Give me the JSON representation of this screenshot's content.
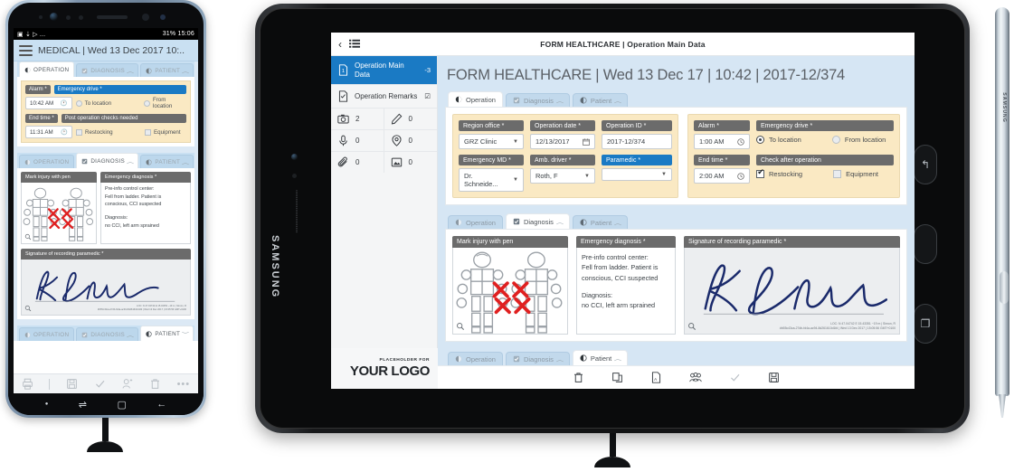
{
  "phone": {
    "statusbar": {
      "left_icons": "▣ ⇣ ▷ ...",
      "right": "31%  15:06"
    },
    "title": "MEDICAL | Wed 13 Dec 2017 10:..",
    "menu_icon": "hamburger-icon",
    "tabs_top": [
      {
        "label": "OPERATION",
        "icon": "operation-icon",
        "active": true,
        "chevron": ""
      },
      {
        "label": "DIAGNOSIS",
        "icon": "diagnosis-icon",
        "active": false,
        "chevron": "︿"
      },
      {
        "label": "PATIENT",
        "icon": "patient-icon",
        "active": false,
        "chevron": "︿"
      }
    ],
    "operation": {
      "alarm_label": "Alarm *",
      "alarm_value": "10:42 AM",
      "emergency_drive_label": "Emergency drive *",
      "to_location": "To location",
      "from_location": "From location",
      "end_time_label": "End time *",
      "end_time_value": "11:31 AM",
      "post_checks_label": "Post operation checks needed",
      "restocking": "Restocking",
      "equipment": "Equipment"
    },
    "tabs_mid": [
      {
        "label": "OPERATION",
        "icon": "operation-icon",
        "active": false,
        "chevron": ""
      },
      {
        "label": "DIAGNOSIS",
        "icon": "diagnosis-icon",
        "active": true,
        "chevron": "︿"
      },
      {
        "label": "PATIENT",
        "icon": "patient-icon",
        "active": false,
        "chevron": "︿"
      }
    ],
    "diagnosis": {
      "mark_injury_label": "Mark injury with pen",
      "emergency_diagnosis_label": "Emergency diagnosis *",
      "emergency_diagnosis_text_1": "Pre-info control center:",
      "emergency_diagnosis_text_2": "Fell from ladder. Patient is",
      "emergency_diagnosis_text_3": "conscious, CCI suspected",
      "emergency_diagnosis_text_4": "Diagnosis:",
      "emergency_diagnosis_text_5": "no CCI, left arm sprained",
      "signature_label": "Signature of recording paramedic *",
      "sig_meta_1": "LOC: N 47.04742  E 15.43351  ~19 m | Simon, R",
      "sig_meta_2": "#b55c43ca-27db-fd4a-ac94-8d261610d1fd | Wed 13 Dec 2017 | 15:05:56 GMT+0100"
    },
    "tabs_bottom": [
      {
        "label": "OPERATION",
        "icon": "operation-icon",
        "active": false,
        "chevron": ""
      },
      {
        "label": "DIAGNOSIS",
        "icon": "diagnosis-icon",
        "active": false,
        "chevron": "︿"
      },
      {
        "label": "PATIENT",
        "icon": "patient-icon",
        "active": true,
        "chevron": "﹀"
      }
    ],
    "bottom_tools": [
      "print-icon",
      "divider",
      "save-icon",
      "check-icon",
      "person-icon",
      "trash-icon",
      "overflow-icon"
    ],
    "nav": [
      "dot-icon",
      "switch-icon",
      "recents-icon",
      "back-icon"
    ]
  },
  "tablet": {
    "brand": "SAMSUNG",
    "side_buttons": [
      "back-button",
      "home-button",
      "recents-button"
    ],
    "app": {
      "topbar_title": "FORM HEALTHCARE | Operation Main Data",
      "back_icon": "chevron-left-icon",
      "list_icon": "list-icon",
      "sidebar": {
        "items": [
          {
            "label": "Operation Main Data",
            "badge": "-3",
            "icon": "document-1-icon",
            "active": true
          },
          {
            "label": "Operation Remarks",
            "badge": "☑",
            "icon": "document-check-icon",
            "active": false
          }
        ],
        "counters": [
          {
            "icon": "camera-icon",
            "value": "2"
          },
          {
            "icon": "pencil-icon",
            "value": "0"
          },
          {
            "icon": "microphone-icon",
            "value": "0"
          },
          {
            "icon": "location-pin-icon",
            "value": "0"
          },
          {
            "icon": "paperclip-icon",
            "value": "0"
          },
          {
            "icon": "image-icon",
            "value": "0"
          }
        ],
        "logo_small": "PLACEHOLDER FOR",
        "logo_big": "YOUR LOGO"
      },
      "doc_title": "FORM HEALTHCARE | Wed 13 Dec 17 | 10:42 | 2017-12/374",
      "panel_operation": {
        "tabs": [
          {
            "label": "Operation",
            "icon": "operation-icon",
            "active": true,
            "chevron": ""
          },
          {
            "label": "Diagnosis",
            "icon": "diagnosis-icon",
            "active": false,
            "chevron": "︿"
          },
          {
            "label": "Patient",
            "icon": "patient-icon",
            "active": false,
            "chevron": "︿"
          }
        ],
        "region_office_label": "Region office *",
        "region_office_value": "GRZ Clinic",
        "operation_date_label": "Operation date *",
        "operation_date_value": "12/13/2017",
        "operation_id_label": "Operation ID *",
        "operation_id_value": "2017-12/374",
        "emergency_md_label": "Emergency MD *",
        "emergency_md_value": "Dr. Schneide...",
        "amb_driver_label": "Amb. driver *",
        "amb_driver_value": "Roth, F",
        "paramedic_label": "Paramedic *",
        "paramedic_value": "",
        "alarm_label": "Alarm *",
        "alarm_value": "1:00 AM",
        "emergency_drive_label": "Emergency drive *",
        "to_location": "To location",
        "from_location": "From location",
        "end_time_label": "End time *",
        "end_time_value": "2:00 AM",
        "check_after_label": "Check after operation",
        "restocking": "Restocking",
        "equipment": "Equipment"
      },
      "panel_diagnosis": {
        "tabs": [
          {
            "label": "Operation",
            "icon": "operation-icon",
            "active": false,
            "chevron": ""
          },
          {
            "label": "Diagnosis",
            "icon": "diagnosis-icon",
            "active": true,
            "chevron": "︿"
          },
          {
            "label": "Patient",
            "icon": "patient-icon",
            "active": false,
            "chevron": "︿"
          }
        ],
        "mark_injury_label": "Mark injury with pen",
        "emergency_diagnosis_label": "Emergency diagnosis *",
        "note_line_1": "Pre-info control center:",
        "note_line_2": "Fell from ladder. Patient is",
        "note_line_3": "conscious, CCI suspected",
        "note_line_4": "Diagnosis:",
        "note_line_5": "no CCI, left arm sprained",
        "signature_label": "Signature of recording paramedic *",
        "sig_meta_1": "LOC: N 47.04742  E 15.43351  ~19 m | Simon, R",
        "sig_meta_2": "#b55c43ca-27db-fd4a-ac94-8d261610d1fd | Wed 13 Dec 2017 | 15:05:56 GMT+0100"
      },
      "panel_patient": {
        "tabs": [
          {
            "label": "Operation",
            "icon": "operation-icon",
            "active": false,
            "chevron": ""
          },
          {
            "label": "Diagnosis",
            "icon": "diagnosis-icon",
            "active": false,
            "chevron": "︿"
          },
          {
            "label": "Patient",
            "icon": "patient-icon",
            "active": true,
            "chevron": "︿"
          }
        ]
      },
      "bottom_toolbar": [
        "trash-icon",
        "copy-icon",
        "pdf-icon",
        "people-icon",
        "check-icon",
        "save-icon"
      ]
    }
  },
  "stylus": {
    "brand": "SAMSUNG"
  },
  "colors": {
    "accent_blue": "#1a7ac4",
    "form_yellow": "#fae9c3",
    "label_gray": "#6b6b6b",
    "panel_blue": "#d6e6f4",
    "phone_panel_blue": "#c9e0f2"
  }
}
